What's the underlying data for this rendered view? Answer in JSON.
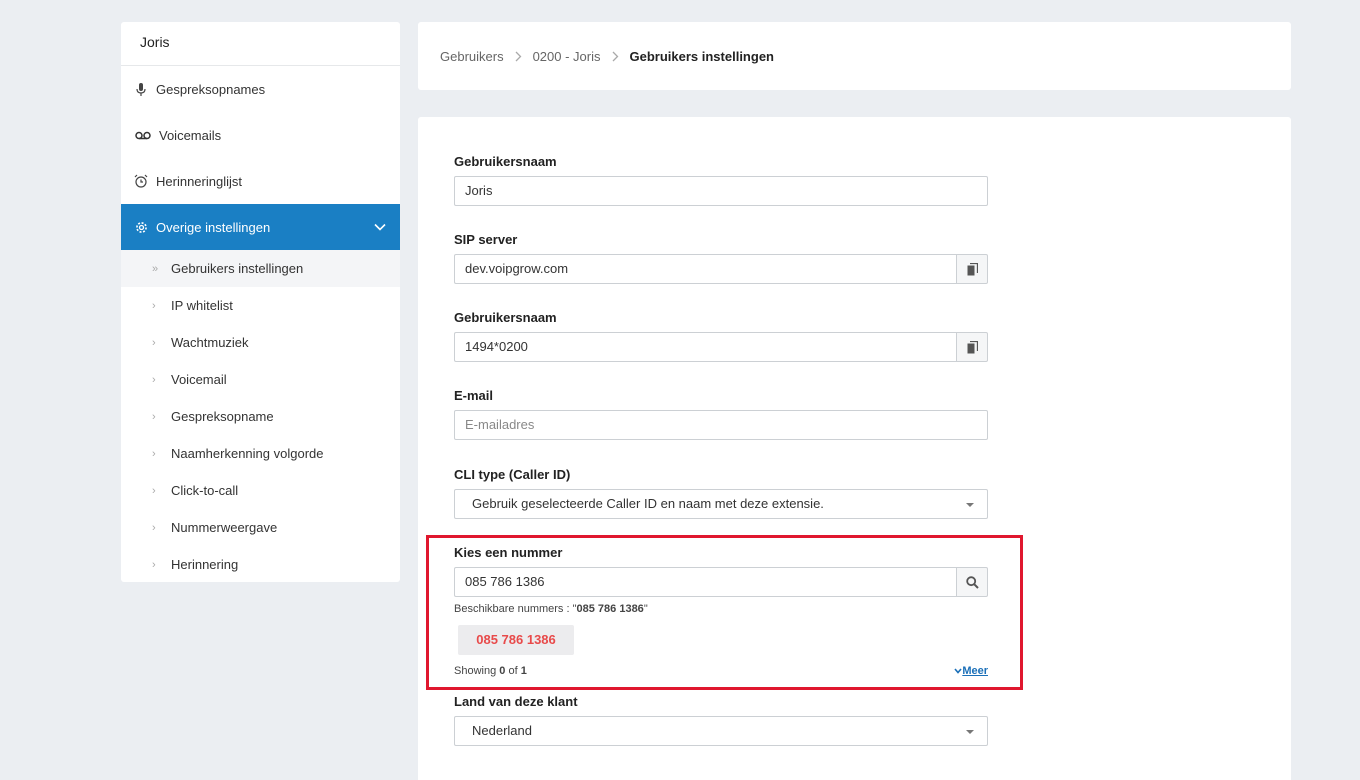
{
  "sidebar": {
    "title": "Joris",
    "items": [
      {
        "label": "Gespreksopnames",
        "icon": "microphone-icon"
      },
      {
        "label": "Voicemails",
        "icon": "voicemail-icon"
      },
      {
        "label": "Herinneringlijst",
        "icon": "alarm-clock-icon"
      },
      {
        "label": "Overige instellingen",
        "icon": "gear-icon"
      }
    ],
    "subitems": [
      "Gebruikers instellingen",
      "IP whitelist",
      "Wachtmuziek",
      "Voicemail",
      "Gespreksopname",
      "Naamherkenning volgorde",
      "Click-to-call",
      "Nummerweergave",
      "Herinnering"
    ]
  },
  "breadcrumb": [
    "Gebruikers",
    "0200 - Joris",
    "Gebruikers instellingen"
  ],
  "form": {
    "username_label": "Gebruikersnaam",
    "username_value": "Joris",
    "sip_label": "SIP server",
    "sip_value": "dev.voipgrow.com",
    "sip_user_label": "Gebruikersnaam",
    "sip_user_value": "1494*0200",
    "email_label": "E-mail",
    "email_placeholder": "E-mailadres",
    "cli_label": "CLI type (Caller ID)",
    "cli_value": "Gebruik geselecteerde Caller ID en naam met deze extensie.",
    "number_label": "Kies een nummer",
    "number_value": "085 786 1386",
    "available_prefix": "Beschikbare nummers : \"",
    "available_number": "085 786 1386",
    "available_suffix": "\"",
    "chip": "085 786 1386",
    "showing_prefix": "Showing ",
    "showing_count": "0",
    "showing_of": " of ",
    "showing_total": "1",
    "more": "Meer",
    "country_label": "Land van deze klant",
    "country_value": "Nederland"
  },
  "colors": {
    "accent": "#1a7fc4",
    "highlight": "#e0172e",
    "chip_text": "#e84a4a"
  }
}
